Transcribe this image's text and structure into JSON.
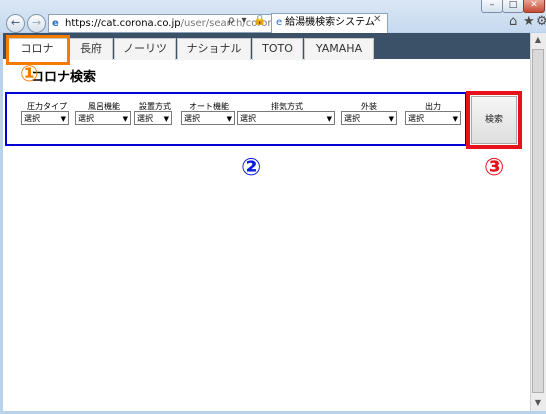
{
  "browser": {
    "url_host": "https://cat.corona.co.jp",
    "url_path": "/user/search/corona",
    "tab_title": "給湯機検索システム",
    "addr_tools": "ρ ▾ 🔒 C",
    "icons": {
      "back": "back-arrow-icon",
      "forward": "forward-arrow-icon",
      "home": "home-icon",
      "star": "favorites-star-icon",
      "gear": "settings-gear-icon"
    }
  },
  "tabs": [
    {
      "label": "コロナ"
    },
    {
      "label": "長府"
    },
    {
      "label": "ノーリツ"
    },
    {
      "label": "ナショナル"
    },
    {
      "label": "TOTO"
    },
    {
      "label": "YAMAHA"
    }
  ],
  "page": {
    "title": "コロナ検索"
  },
  "filters": [
    {
      "label": "圧力タイプ",
      "value": "選択"
    },
    {
      "label": "風呂機能",
      "value": "選択"
    },
    {
      "label": "設置方式",
      "value": "選択"
    },
    {
      "label": "オート機能",
      "value": "選択"
    },
    {
      "label": "排気方式",
      "value": "選択"
    },
    {
      "label": "外装",
      "value": "選択"
    },
    {
      "label": "出力",
      "value": "選択"
    }
  ],
  "search_button": {
    "label": "検索"
  },
  "markers": {
    "one": "①",
    "two": "②",
    "three": "③"
  },
  "colors": {
    "orange": "#f57c00",
    "blue": "#0000d4",
    "red": "#e8101a",
    "nav_bg": "#3a5168"
  }
}
